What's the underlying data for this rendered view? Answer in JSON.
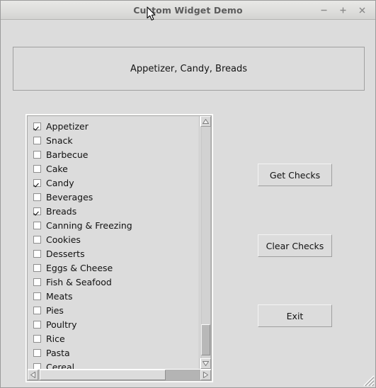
{
  "window": {
    "title": "Custom Widget Demo",
    "controls": [
      {
        "name": "minimize",
        "glyph": "−"
      },
      {
        "name": "maximize",
        "glyph": "+"
      },
      {
        "name": "close",
        "glyph": "×"
      }
    ]
  },
  "display": {
    "text": "Appetizer, Candy, Breads"
  },
  "checklist": {
    "items": [
      {
        "label": "Appetizer",
        "checked": true
      },
      {
        "label": "Snack",
        "checked": false
      },
      {
        "label": "Barbecue",
        "checked": false
      },
      {
        "label": "Cake",
        "checked": false
      },
      {
        "label": "Candy",
        "checked": true
      },
      {
        "label": "Beverages",
        "checked": false
      },
      {
        "label": "Breads",
        "checked": true
      },
      {
        "label": "Canning & Freezing",
        "checked": false
      },
      {
        "label": "Cookies",
        "checked": false
      },
      {
        "label": "Desserts",
        "checked": false
      },
      {
        "label": "Eggs & Cheese",
        "checked": false
      },
      {
        "label": "Fish & Seafood",
        "checked": false
      },
      {
        "label": "Meats",
        "checked": false
      },
      {
        "label": "Pies",
        "checked": false
      },
      {
        "label": "Poultry",
        "checked": false
      },
      {
        "label": "Rice",
        "checked": false
      },
      {
        "label": "Pasta",
        "checked": false
      },
      {
        "label": "Cereal",
        "checked": false
      }
    ]
  },
  "buttons": {
    "get_checks": "Get Checks",
    "clear_checks": "Clear Checks",
    "exit": "Exit"
  },
  "colors": {
    "window_background": "#dcdcdc",
    "titlebar": "#e0e0de",
    "title_text": "#5c5c5c",
    "checkbox_fill": "#ffffff",
    "scrollbar_thumb": "#b8b8b8"
  }
}
